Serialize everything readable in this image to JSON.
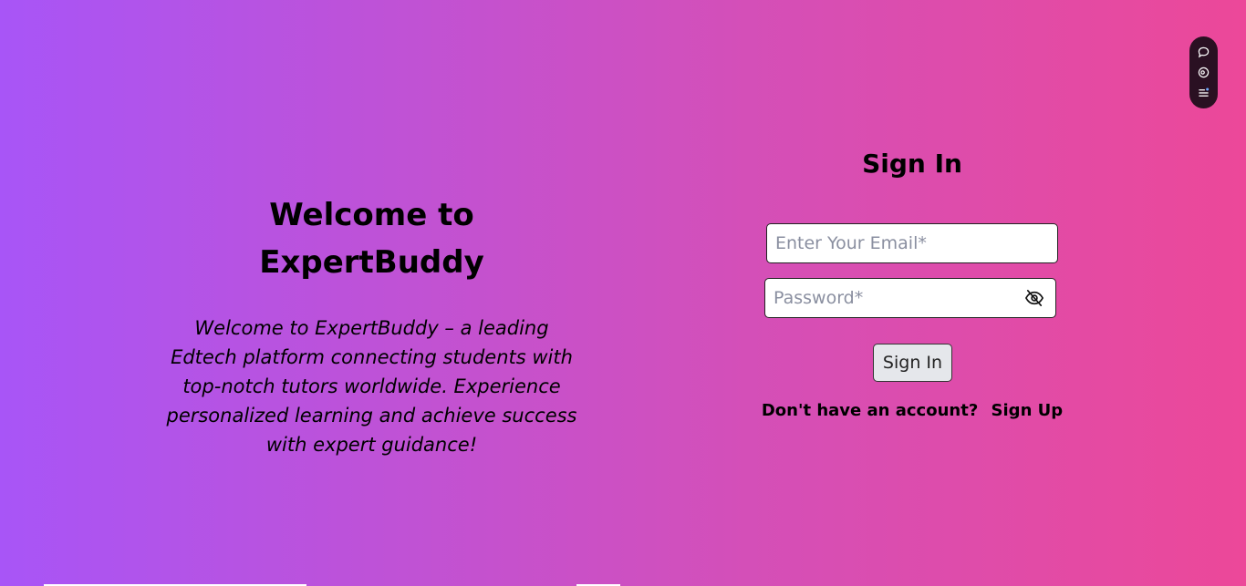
{
  "left": {
    "title": "Welcome to ExpertBuddy",
    "description": "Welcome to ExpertBuddy – a leading Edtech platform connecting students with top-notch tutors worldwide. Experience personalized learning and achieve success with expert guidance!"
  },
  "signin": {
    "title": "Sign In",
    "email_placeholder": "Enter Your Email*",
    "password_placeholder": "Password*",
    "button_label": "Sign In",
    "no_account_text": "Don't have an account?",
    "signup_label": "Sign Up"
  },
  "toolbar": {
    "icons": [
      "chat-icon",
      "eye-icon",
      "list-icon"
    ]
  },
  "colors": {
    "gradient_start": "#a855f7",
    "gradient_end": "#ec4899",
    "toolbar_bg": "#2a1022"
  }
}
